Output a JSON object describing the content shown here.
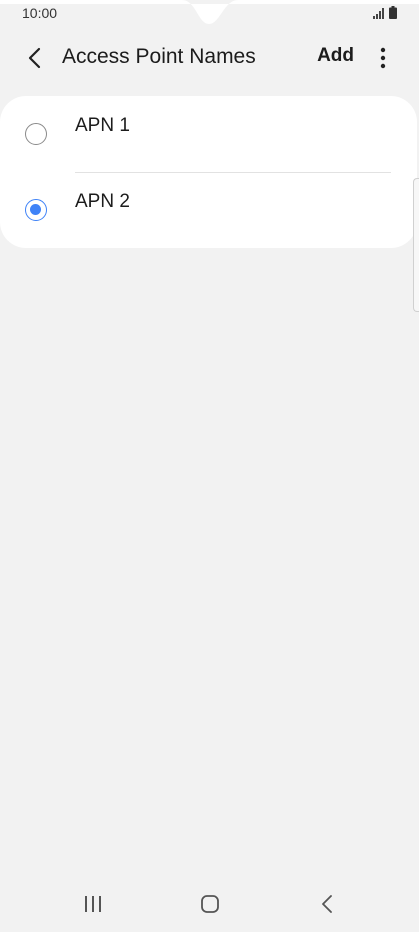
{
  "status_bar": {
    "time": "10:00",
    "icons": [
      "signal-icon",
      "battery-icon"
    ]
  },
  "app_bar": {
    "title": "Access Point Names",
    "add_label": "Add",
    "icons": [
      "back-arrow-icon",
      "more-vertical-icon"
    ]
  },
  "apn_list": {
    "items": [
      {
        "label": "APN 1",
        "selected": false
      },
      {
        "label": "APN 2",
        "selected": true
      }
    ]
  },
  "nav_bar": {
    "icons": [
      "recents-icon",
      "home-icon",
      "back-icon"
    ]
  },
  "colors": {
    "background": "#f2f2f2",
    "card": "#ffffff",
    "accent": "#3e82f7",
    "text": "#1c1c1c"
  }
}
